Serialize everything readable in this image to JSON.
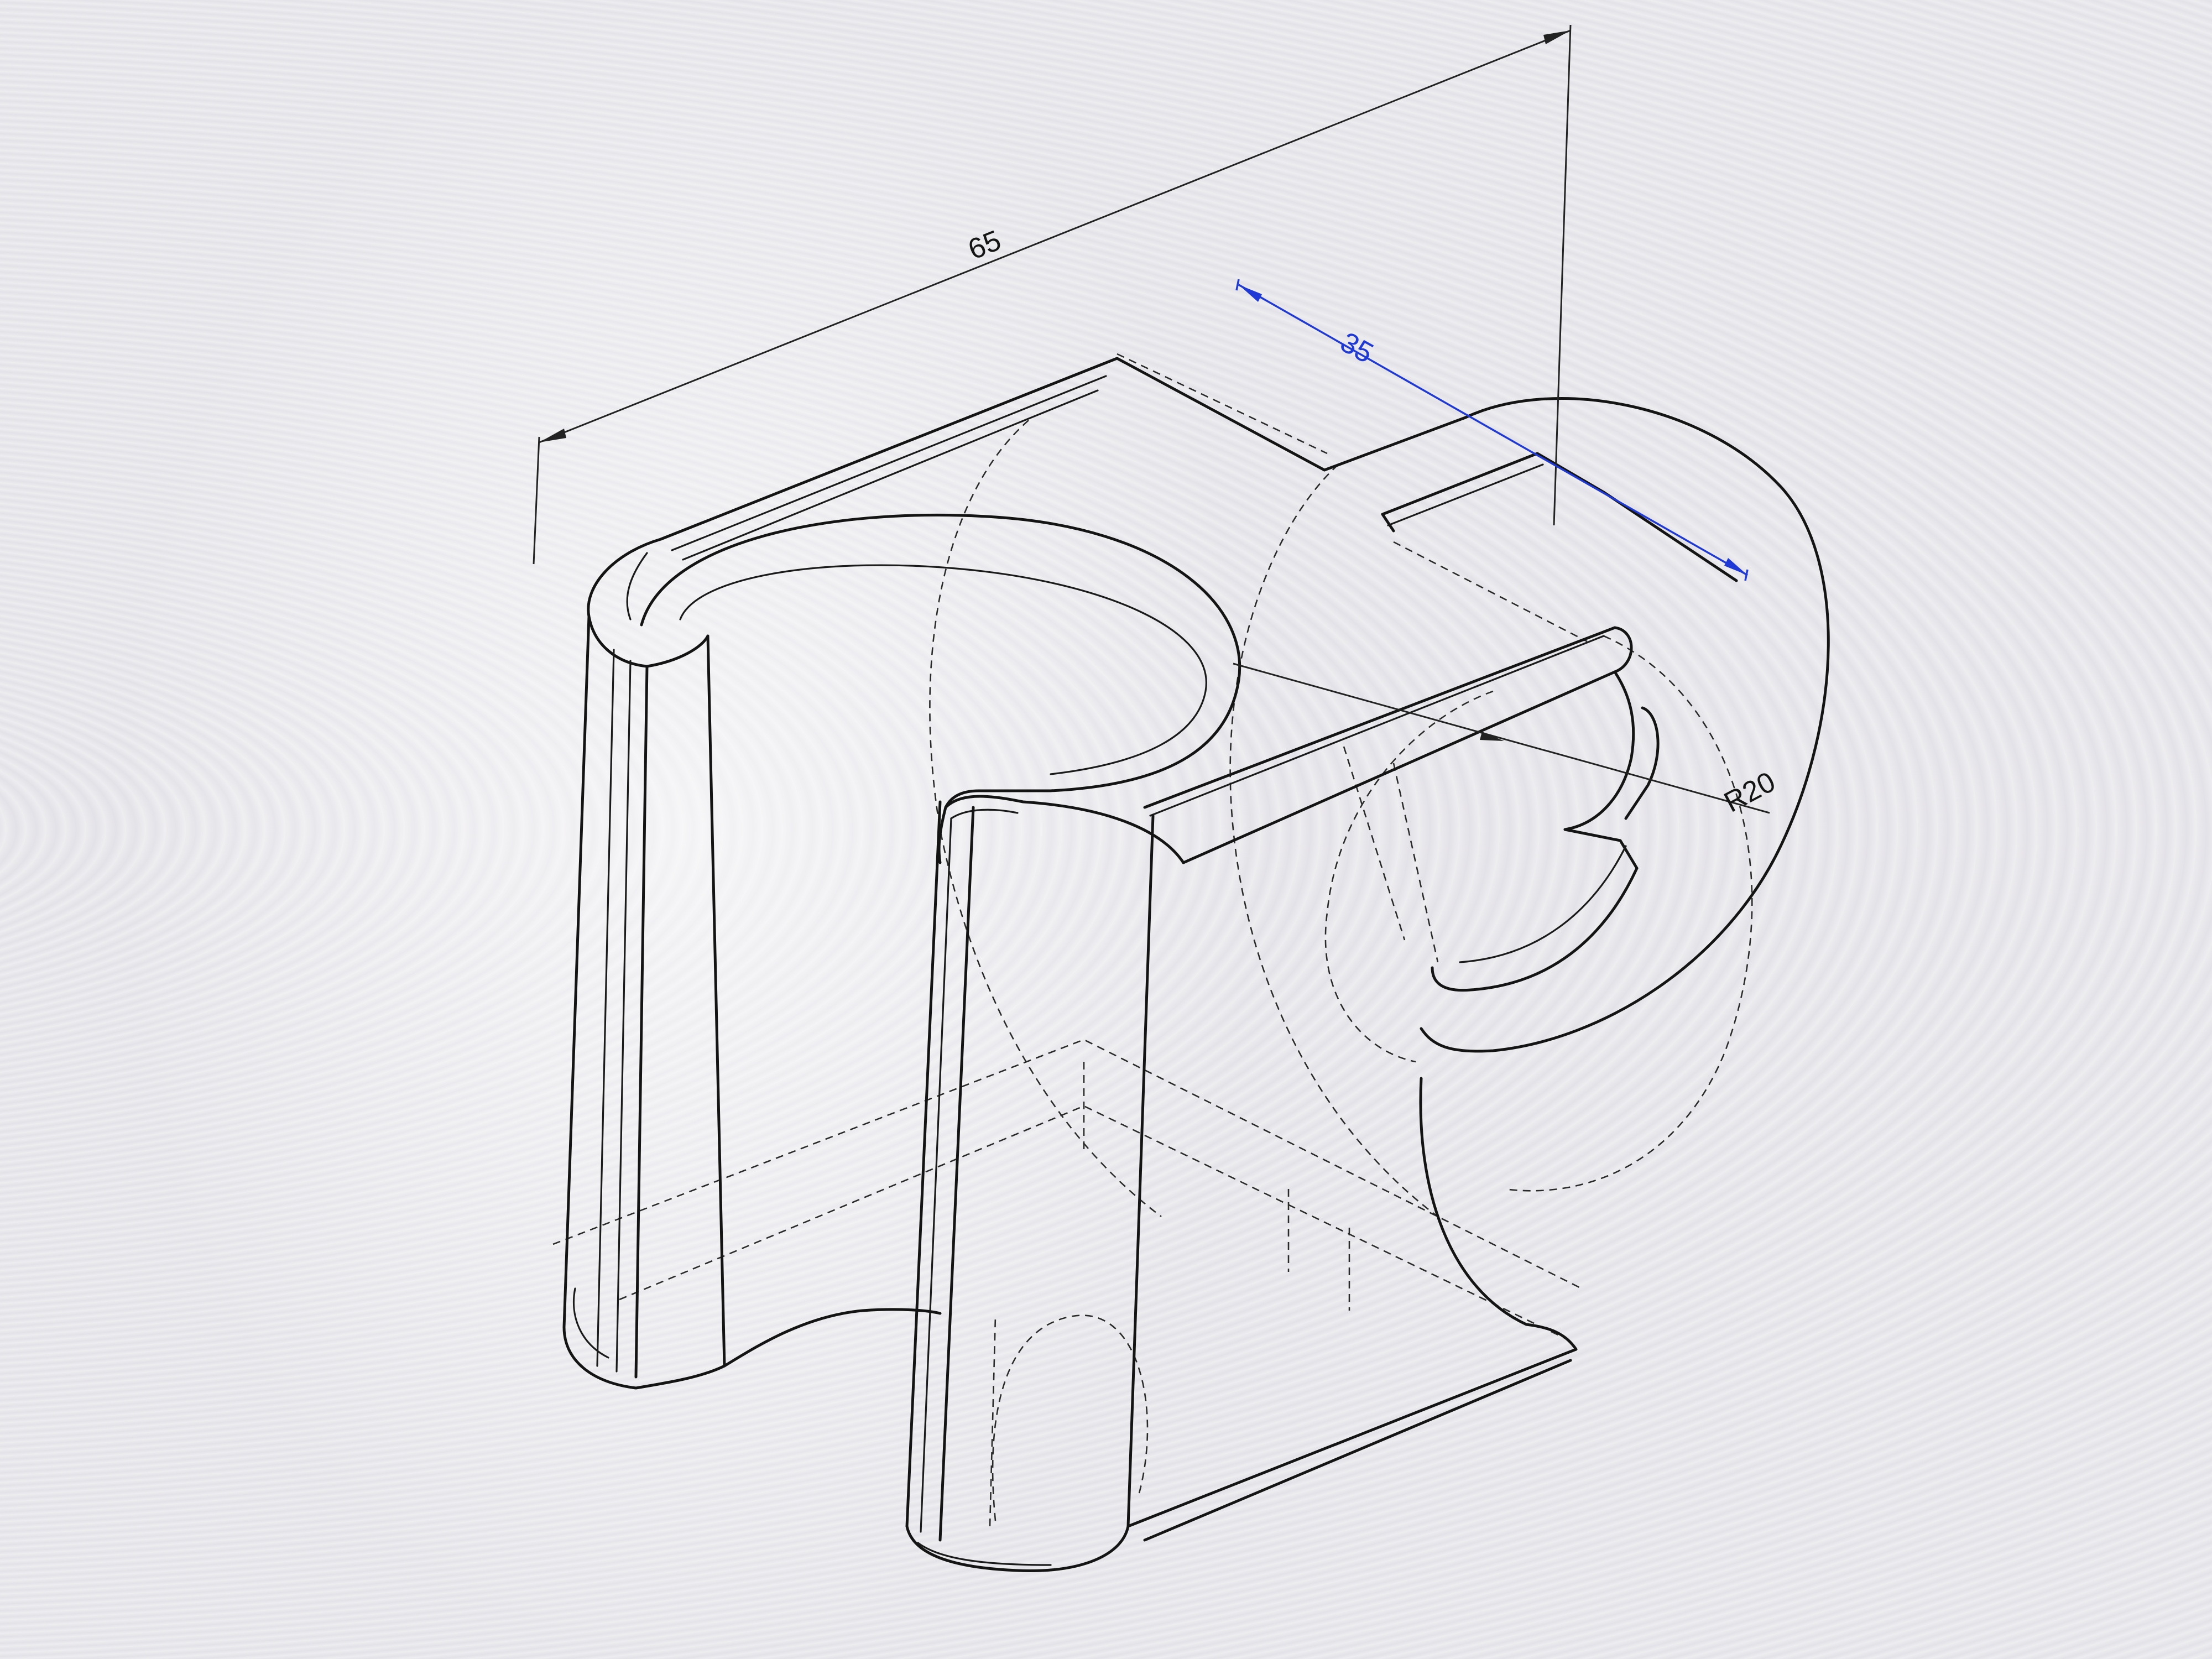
{
  "dimensions": {
    "overall_length": "65",
    "depth": "35",
    "radius": "R20"
  },
  "colors": {
    "background": "#e8e8eb",
    "geometry": "#141414",
    "dimension": "#222222",
    "selected_dimension": "#1f39d6"
  }
}
